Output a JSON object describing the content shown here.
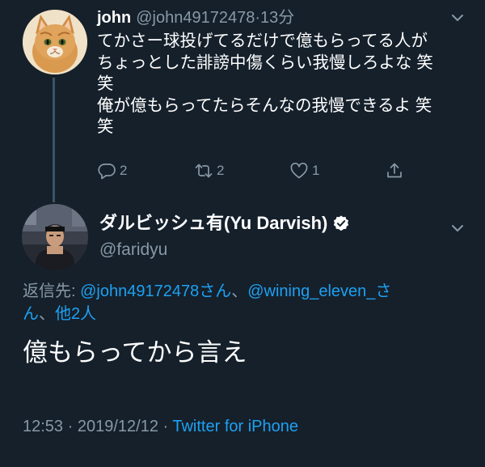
{
  "tweet1": {
    "name": "john",
    "handle": "@john49172478",
    "separator": "·",
    "time": "13分",
    "body_lines": [
      "てかさー球投げてるだけで億もらってる人が",
      "ちょっとした誹謗中傷くらい我慢しろよな 笑",
      "笑",
      "俺が億もらってたらそんなの我慢できるよ 笑",
      "笑"
    ],
    "actions": {
      "reply_count": "2",
      "retweet_count": "2",
      "like_count": "1"
    },
    "icons": [
      "cat-avatar",
      "chevron-down-icon",
      "reply-icon",
      "retweet-icon",
      "like-icon",
      "share-icon"
    ]
  },
  "tweet2": {
    "name": "ダルビッシュ有(Yu Darvish)",
    "verified": true,
    "handle": "@faridyu",
    "reply_prefix": "返信先: ",
    "reply_line1_mention1": "@john49172478さん",
    "reply_line1_sep": "、",
    "reply_line1_mention2": "@wining_eleven_さ",
    "reply_line2_mention2_tail": "ん",
    "reply_line2_sep": "、",
    "reply_line2_others": "他2人",
    "body": "億もらってから言え",
    "time": "12:53",
    "dot": " · ",
    "date": "2019/12/12",
    "source": "Twitter for iPhone"
  },
  "colors": {
    "background": "#15202b",
    "text": "#ffffff",
    "muted": "#8899a6",
    "link": "#1da1f2",
    "thread_line": "#3d5466"
  }
}
